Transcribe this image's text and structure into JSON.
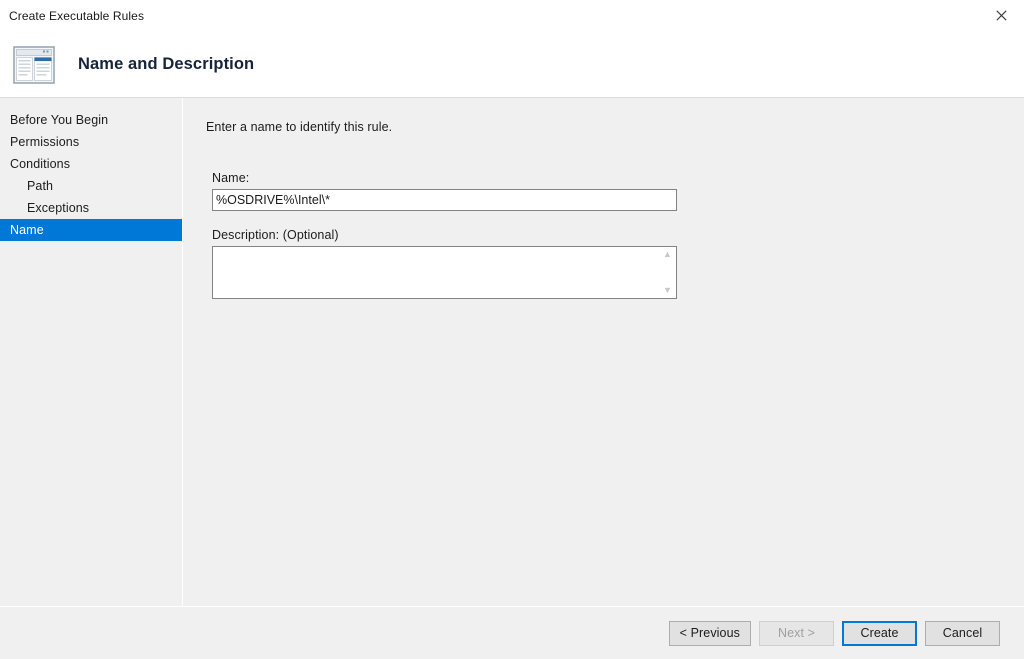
{
  "window": {
    "title": "Create Executable Rules",
    "close_icon": "close-icon"
  },
  "header": {
    "title": "Name and Description",
    "icon": "wizard-page-icon"
  },
  "sidebar": {
    "items": [
      {
        "label": "Before You Begin",
        "indent": false,
        "selected": false
      },
      {
        "label": "Permissions",
        "indent": false,
        "selected": false
      },
      {
        "label": "Conditions",
        "indent": false,
        "selected": false
      },
      {
        "label": "Path",
        "indent": true,
        "selected": false
      },
      {
        "label": "Exceptions",
        "indent": true,
        "selected": false
      },
      {
        "label": "Name",
        "indent": false,
        "selected": true
      }
    ]
  },
  "content": {
    "intro": "Enter a name to identify this rule.",
    "name_field": {
      "label": "Name:",
      "value": "%OSDRIVE%\\Intel\\*",
      "placeholder": ""
    },
    "description_field": {
      "label": "Description: (Optional)",
      "value": "",
      "placeholder": "",
      "scroll_up_icon": "chevron-up-icon",
      "scroll_down_icon": "chevron-down-icon"
    }
  },
  "footer": {
    "buttons": [
      {
        "label": "< Previous",
        "state": "enabled"
      },
      {
        "label": "Next >",
        "state": "disabled"
      },
      {
        "label": "Create",
        "state": "default"
      },
      {
        "label": "Cancel",
        "state": "enabled"
      }
    ]
  },
  "colors": {
    "accent": "#0078d7",
    "window_bg": "#f0f0f0",
    "header_bg": "#ffffff",
    "heading_text": "#16243a"
  }
}
